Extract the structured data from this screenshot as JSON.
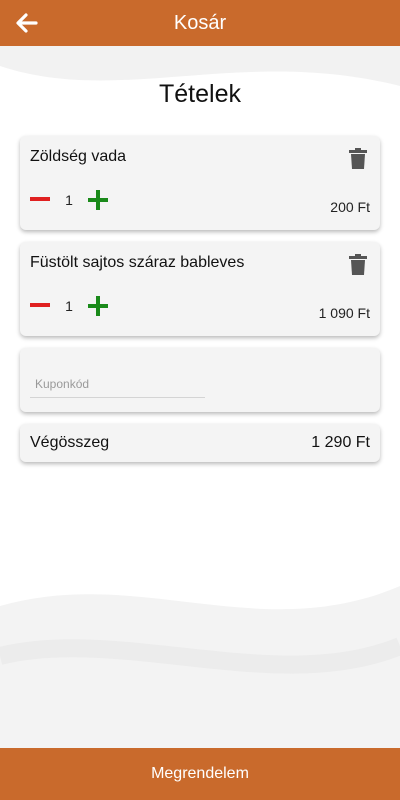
{
  "header": {
    "title": "Kosár",
    "back_icon": "arrow-left-icon"
  },
  "section_title": "Tételek",
  "items": [
    {
      "name": "Zöldség vada",
      "quantity": "1",
      "price": "200 Ft"
    },
    {
      "name": "Füstölt sajtos száraz bableves",
      "quantity": "1",
      "price": "1 090 Ft"
    }
  ],
  "coupon": {
    "placeholder": "Kuponkód",
    "value": ""
  },
  "total": {
    "label": "Végösszeg",
    "value": "1 290 Ft"
  },
  "order_button": {
    "label": "Megrendelem"
  },
  "colors": {
    "accent": "#c96a2c",
    "minus": "#e02020",
    "plus": "#1a8a1a",
    "trash": "#555555"
  }
}
